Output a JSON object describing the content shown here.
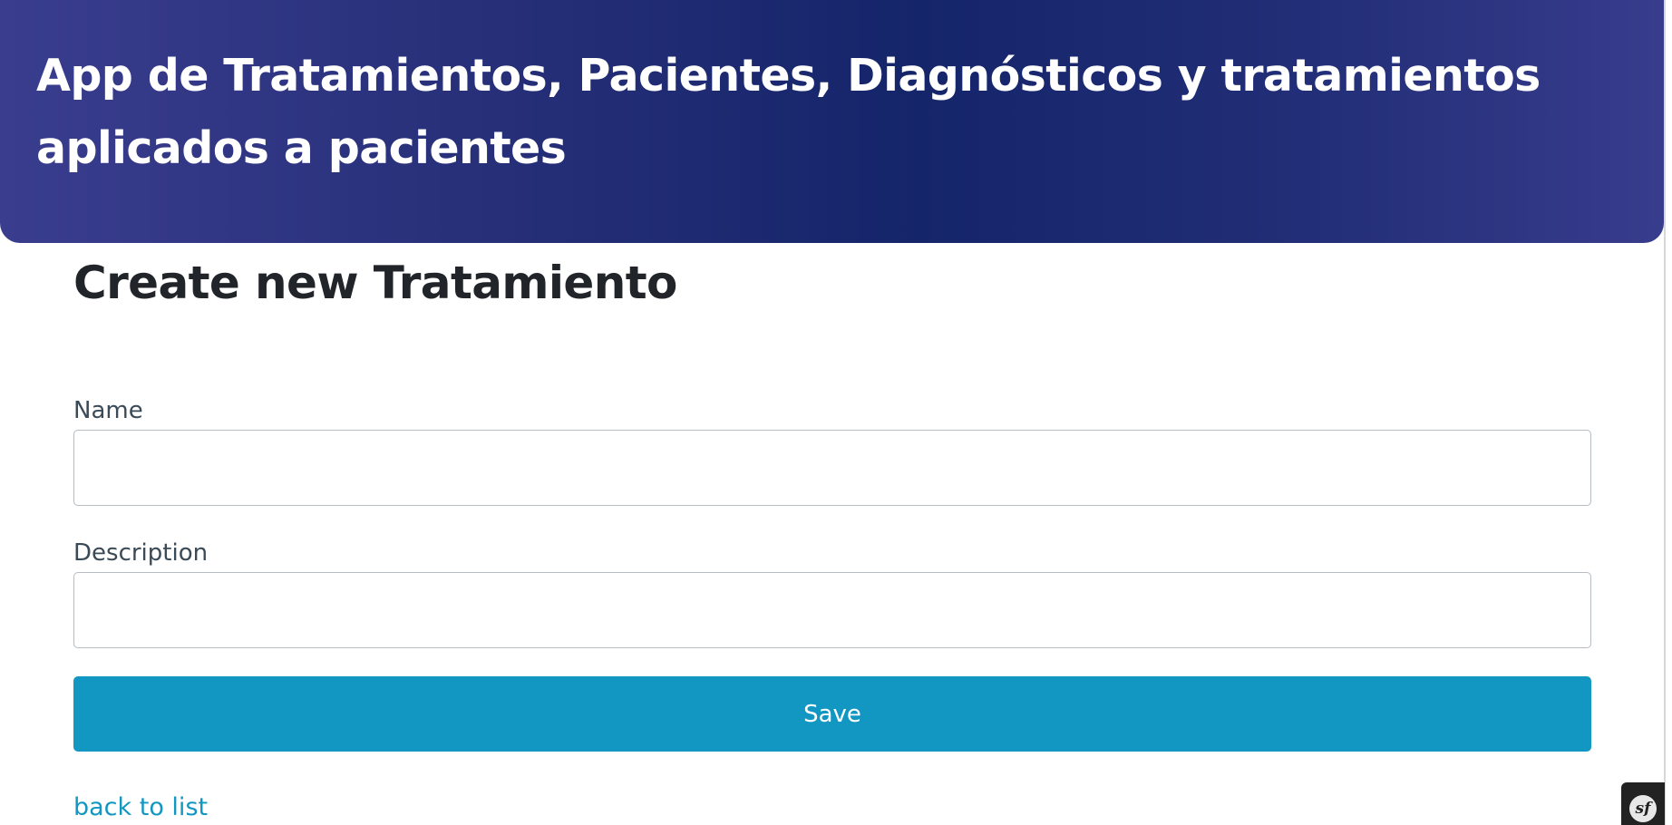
{
  "header": {
    "title": "App de Tratamientos, Pacientes, Diagnósticos y tratamientos aplicados a pacientes"
  },
  "main": {
    "title": "Create new Tratamiento"
  },
  "form": {
    "name": {
      "label": "Name",
      "value": ""
    },
    "description": {
      "label": "Description",
      "value": ""
    },
    "save_label": "Save"
  },
  "links": {
    "back_label": "back to list"
  },
  "toolbar": {
    "logo_text": "sf",
    "icon": "symfony-icon"
  },
  "colors": {
    "header_gradient": [
      "#3a3d8e",
      "#15256a",
      "#383c8c"
    ],
    "primary": "#1296c2",
    "link": "#1296c2",
    "text_dark": "#212529",
    "label": "#3b4a57",
    "input_border": "#b6bcc4"
  }
}
